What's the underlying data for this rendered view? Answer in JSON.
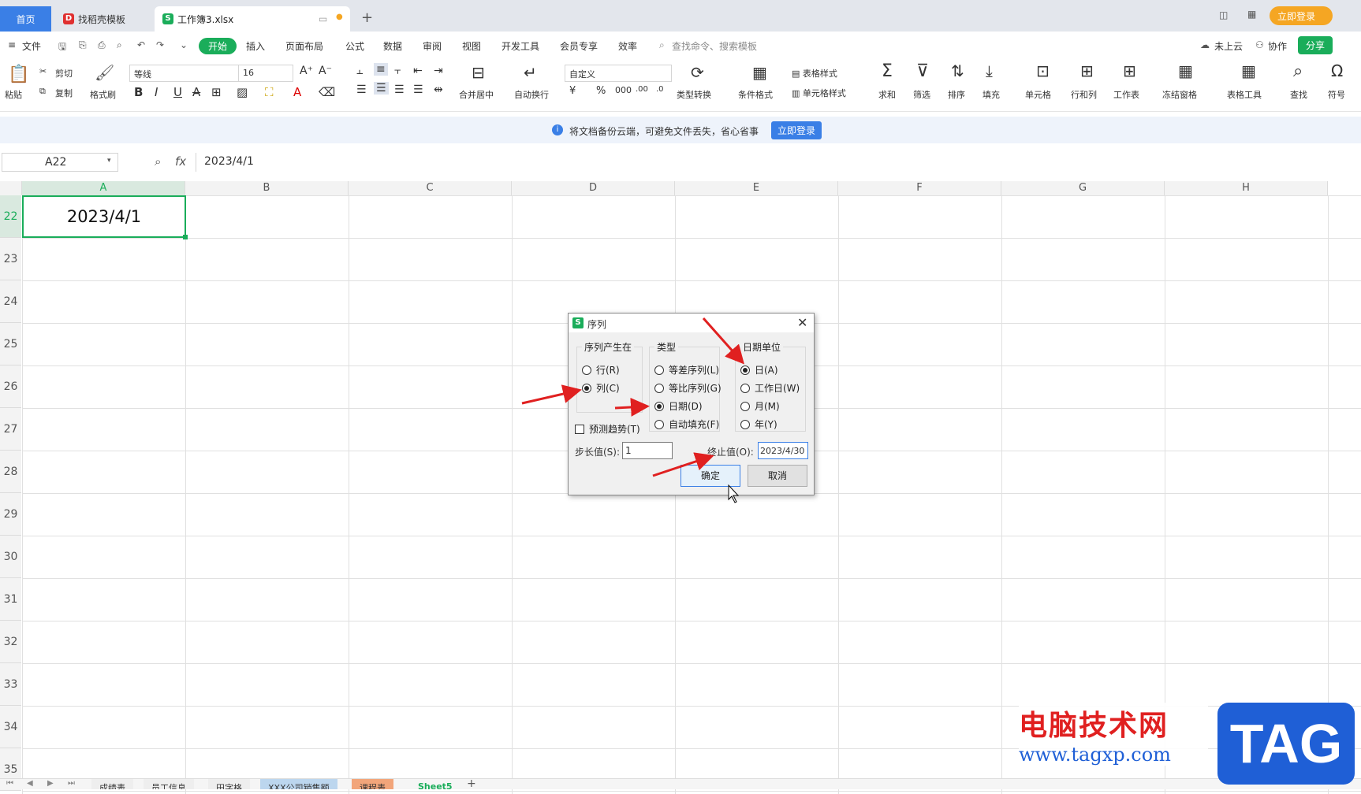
{
  "tabs": {
    "home": "首页",
    "template": "找稻壳模板",
    "workbook": "工作簿3.xlsx",
    "login": "立即登录"
  },
  "menu": {
    "file": "文件",
    "items": [
      "开始",
      "插入",
      "页面布局",
      "公式",
      "数据",
      "审阅",
      "视图",
      "开发工具",
      "会员专享",
      "效率"
    ],
    "search_placeholder": "查找命令、搜索模板",
    "cloud": "未上云",
    "collab": "协作",
    "share": "分享"
  },
  "ribbon": {
    "paste": "粘贴",
    "cut": "剪切",
    "copy": "复制",
    "format_painter": "格式刷",
    "font": "等线",
    "size": "16",
    "merge": "合并居中",
    "wrap": "自动换行",
    "numfmt": "自定义",
    "convert": "类型转换",
    "cond": "条件格式",
    "table_style": "表格样式",
    "cell_style": "单元格样式",
    "sum": "求和",
    "filter": "筛选",
    "sort": "排序",
    "fill": "填充",
    "cell": "单元格",
    "rowcol": "行和列",
    "sheet": "工作表",
    "freeze": "冻结窗格",
    "tools": "表格工具",
    "find": "查找",
    "symbol": "符号"
  },
  "notice": {
    "text": "将文档备份云端，可避免文件丢失，省心省事",
    "button": "立即登录"
  },
  "formula": {
    "cell_ref": "A22",
    "fx": "fx",
    "value": "2023/4/1"
  },
  "grid": {
    "columns": [
      "A",
      "B",
      "C",
      "D",
      "E",
      "F",
      "G",
      "H"
    ],
    "rows": [
      "22",
      "23",
      "24",
      "25",
      "26",
      "27",
      "28",
      "29",
      "30",
      "31",
      "32",
      "33",
      "34",
      "35"
    ],
    "a22": "2023/4/1"
  },
  "dialog": {
    "title": "序列",
    "group1": {
      "title": "序列产生在",
      "options": [
        "行(R)",
        "列(C)"
      ],
      "selected": 1
    },
    "group2": {
      "title": "类型",
      "options": [
        "等差序列(L)",
        "等比序列(G)",
        "日期(D)",
        "自动填充(F)"
      ],
      "selected": 2
    },
    "group3": {
      "title": "日期单位",
      "options": [
        "日(A)",
        "工作日(W)",
        "月(M)",
        "年(Y)"
      ],
      "selected": 0
    },
    "trend": "预测趋势(T)",
    "step_label": "步长值(S):",
    "step_value": "1",
    "stop_label": "终止值(O):",
    "stop_value": "2023/4/30",
    "ok": "确定",
    "cancel": "取消"
  },
  "sheets": [
    "成绩表",
    "员工信息",
    "田字格",
    "XXX公司销售额",
    "课程表",
    "Sheet5"
  ],
  "watermark": {
    "site": "电脑技术网",
    "url": "www.tagxp.com",
    "tag": "TAG"
  },
  "colors": {
    "accent": "#3a7fe6",
    "green": "#1aad5a",
    "arrow": "#e02020",
    "orange": "#f5a623"
  }
}
